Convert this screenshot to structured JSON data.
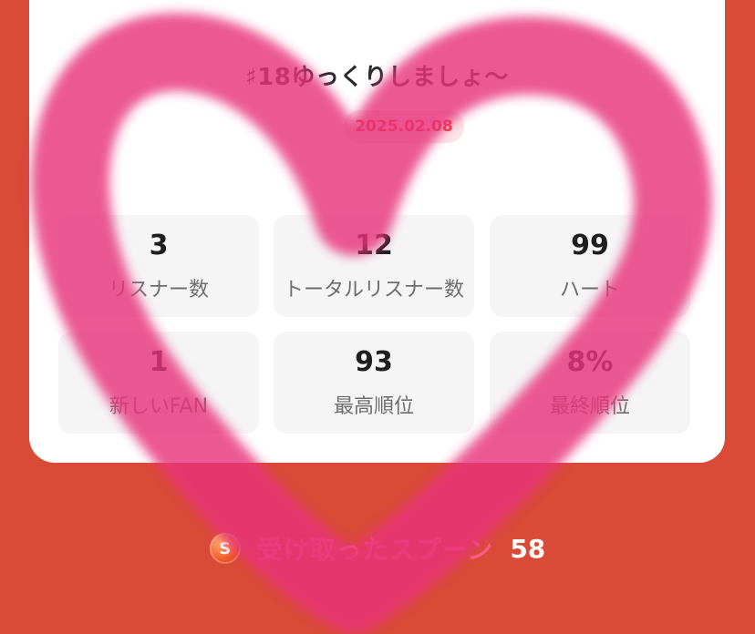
{
  "title": "♯18ゆっくりしましょ〜",
  "date": "2025.02.08",
  "stats": [
    {
      "value": "3",
      "label": "リスナー数"
    },
    {
      "value": "12",
      "label": "トータルリスナー数"
    },
    {
      "value": "99",
      "label": "ハート"
    },
    {
      "value": "1",
      "label": "新しいFAN"
    },
    {
      "value": "93",
      "label": "最高順位"
    },
    {
      "value": "8%",
      "label": "最終順位"
    }
  ],
  "spoons": {
    "icon": "spoon-coin-icon",
    "icon_letter": "S",
    "label": "受け取ったスプーン",
    "count": "58"
  },
  "colors": {
    "background": "#d94a37",
    "card": "#ffffff",
    "date_text": "#ef3a3a",
    "date_bg": "#fde4e6",
    "spoon_label": "#ff5c8a",
    "heart_doodle": "#e8357a"
  }
}
